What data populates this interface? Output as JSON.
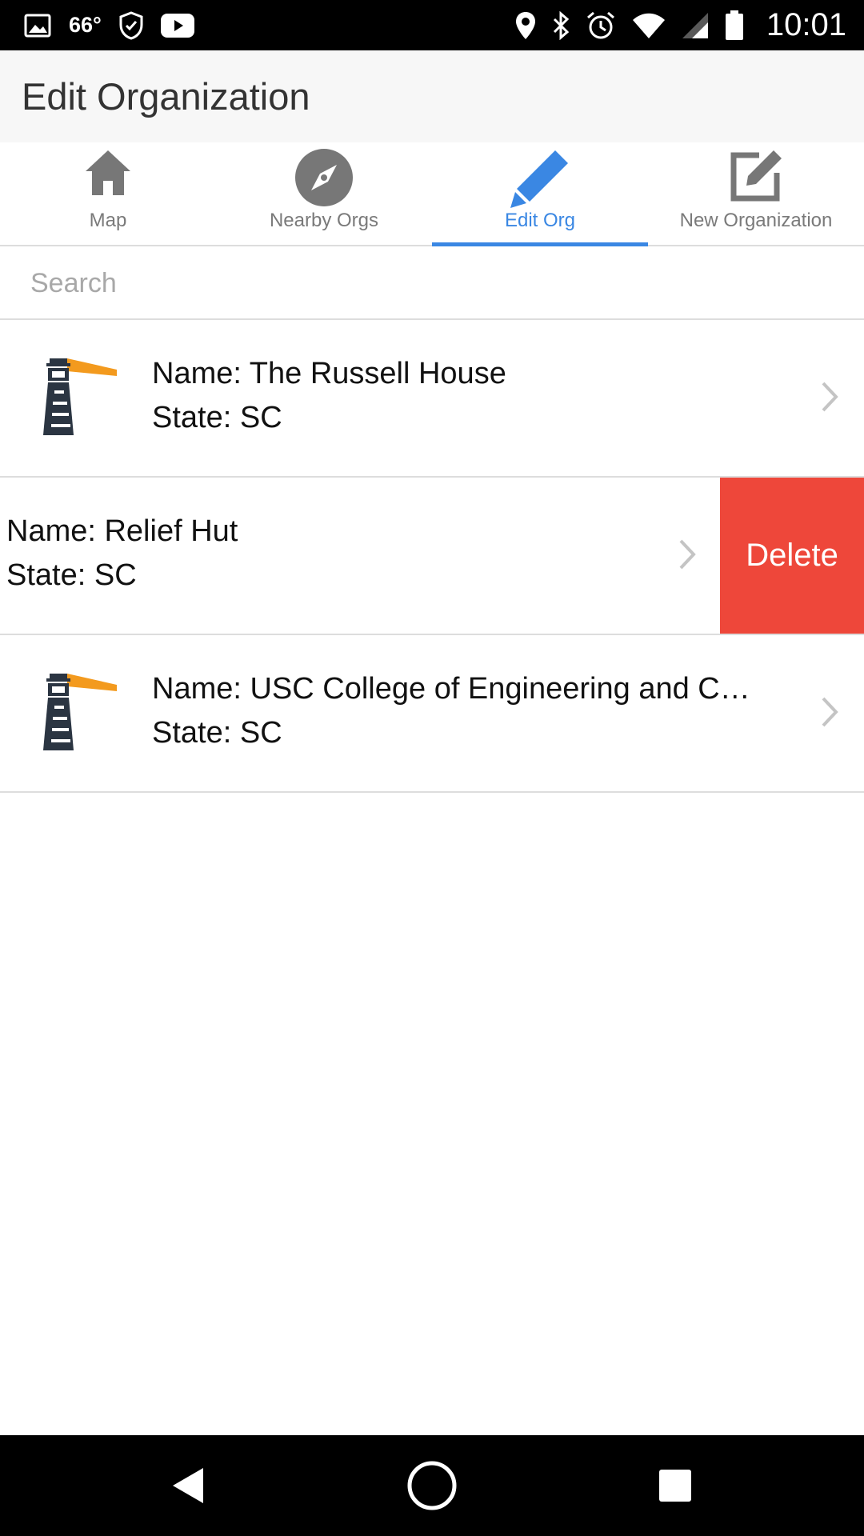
{
  "status_bar": {
    "temperature": "66°",
    "time": "10:01",
    "icons": [
      "image-icon",
      "shield-check-icon",
      "youtube-icon",
      "location-icon",
      "bluetooth-icon",
      "alarm-icon",
      "wifi-icon",
      "signal-icon",
      "battery-icon"
    ]
  },
  "header": {
    "title": "Edit Organization"
  },
  "tabs": [
    {
      "label": "Map",
      "icon": "home-icon",
      "active": false
    },
    {
      "label": "Nearby Orgs",
      "icon": "compass-icon",
      "active": false
    },
    {
      "label": "Edit Org",
      "icon": "pencil-icon",
      "active": true
    },
    {
      "label": "New Organization",
      "icon": "edit-square-icon",
      "active": false
    }
  ],
  "search": {
    "placeholder": "Search",
    "value": ""
  },
  "organizations": [
    {
      "name": "Name: The Russell House",
      "state": "State: SC",
      "logo": "lighthouse-icon"
    },
    {
      "name": "Name: Relief Hut",
      "state": "State: SC",
      "action_label": "Delete"
    },
    {
      "name": "Name: USC College of Engineering and Computing",
      "state": "State: SC",
      "logo": "lighthouse-icon"
    }
  ],
  "colors": {
    "accent": "#3a87e3",
    "delete": "#ee473a",
    "header_bg": "#f7f7f7",
    "lighthouse_dark": "#2b3542",
    "lighthouse_orange": "#f39a1e"
  },
  "nav_bar": {
    "buttons": [
      "back-icon",
      "home-circle-icon",
      "recents-icon"
    ]
  }
}
